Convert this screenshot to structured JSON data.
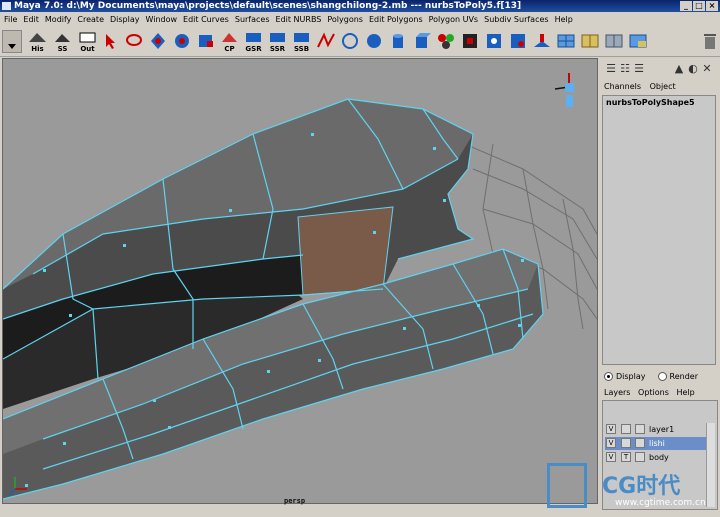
{
  "window": {
    "title": "Maya 7.0: d:\\My Documents\\maya\\projects\\default\\scenes\\shangchilong-2.mb  ---  nurbsToPoly5.f[13]"
  },
  "menus": [
    "File",
    "Edit",
    "Modify",
    "Create",
    "Display",
    "Window",
    "Edit Curves",
    "Surfaces",
    "Edit NURBS",
    "Polygons",
    "Edit Polygons",
    "Polygon UVs",
    "Subdiv Surfaces",
    "Help"
  ],
  "shelf": {
    "labeled_buttons": [
      "His",
      "SS",
      "Out",
      "CP",
      "GSR",
      "SSR",
      "SSB"
    ]
  },
  "viewport": {
    "camera_label": "persp",
    "colors": {
      "background": "#9a9a9a",
      "wireframe": "#5fd3f0",
      "face_selected": "#7a5a48"
    }
  },
  "channel_box": {
    "tabs": [
      "Channels",
      "Object"
    ],
    "object_name": "nurbsToPolyShape5"
  },
  "layer_editor": {
    "modes": [
      "Display",
      "Render"
    ],
    "selected_mode": "Display",
    "menus": [
      "Layers",
      "Options",
      "Help"
    ],
    "layers": [
      {
        "v": "V",
        "t": "",
        "name": "layer1",
        "selected": false
      },
      {
        "v": "V",
        "t": "",
        "name": "lishi",
        "selected": true
      },
      {
        "v": "V",
        "t": "T",
        "name": "body",
        "selected": false
      }
    ]
  },
  "watermark": {
    "brand": "CG时代",
    "url": "www.cgtime.com.cn"
  }
}
